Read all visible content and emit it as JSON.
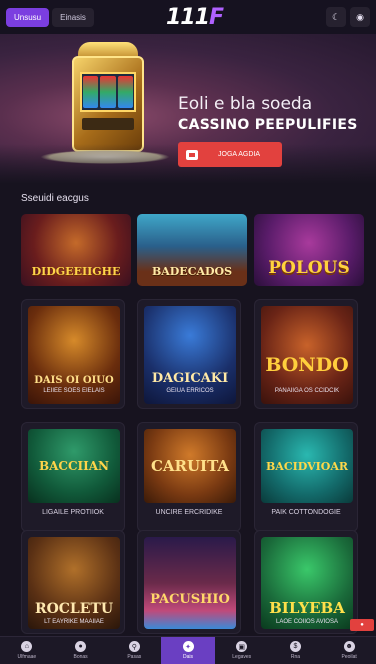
{
  "header": {
    "tabs": [
      {
        "label": "Unsusu",
        "active": true
      },
      {
        "label": "Einasis",
        "active": false
      }
    ],
    "logo_main": "111",
    "logo_accent": "F",
    "icons": [
      "moon-icon",
      "settings-icon"
    ]
  },
  "hero": {
    "line1": "Eoli e bla soeda",
    "line2": "CASSINO PEEPULIFIES",
    "button_label": "JOGA AGDIA"
  },
  "section": {
    "title": "Sseuidi eacgus"
  },
  "featured": [
    {
      "title": "DIDGEEIIGHE",
      "color": "#ffd54a"
    },
    {
      "title": "BADECADOS",
      "color": "#ffe9a6"
    },
    {
      "title": "POLOUS",
      "color": "#ffd23d"
    }
  ],
  "games": [
    {
      "title": "DAIS OI OIUO",
      "subtitle": "LEIIEE SOES EIELAIS"
    },
    {
      "title": "DAGICAKI",
      "subtitle": "GEIUA ERRICOS"
    },
    {
      "title": "BONDO",
      "subtitle": "PANAIIGA OS CCIDCIK"
    },
    {
      "title": "BACCIIAN",
      "subtitle": "LIGAILE PROTIIOK"
    },
    {
      "title": "CARUITA",
      "subtitle": "UNCIRE ERCRIDIKE"
    },
    {
      "title": "BACIDVIOAR",
      "subtitle": "PAIK COTTONDOGIE"
    },
    {
      "title": "ROCLETU",
      "subtitle": "LT EAYRIKE MAAIIAE"
    },
    {
      "title": "PACUSHIO",
      "subtitle": ""
    },
    {
      "title": "BILYEBA",
      "subtitle": "LAOE COIIOS AVIOSA"
    }
  ],
  "live_badge": "●",
  "bottom_nav": [
    {
      "label": "Ulfmaae",
      "icon": "home-icon",
      "active": false
    },
    {
      "label": "Bonas",
      "icon": "coin-icon",
      "active": false
    },
    {
      "label": "Pasas",
      "icon": "search-icon",
      "active": false
    },
    {
      "label": "Dais",
      "icon": "star-icon",
      "active": true
    },
    {
      "label": "Legaves",
      "icon": "gift-icon",
      "active": false
    },
    {
      "label": "Rna",
      "icon": "wallet-icon",
      "active": false
    },
    {
      "label": "Peoilat",
      "icon": "user-icon",
      "active": false
    }
  ]
}
